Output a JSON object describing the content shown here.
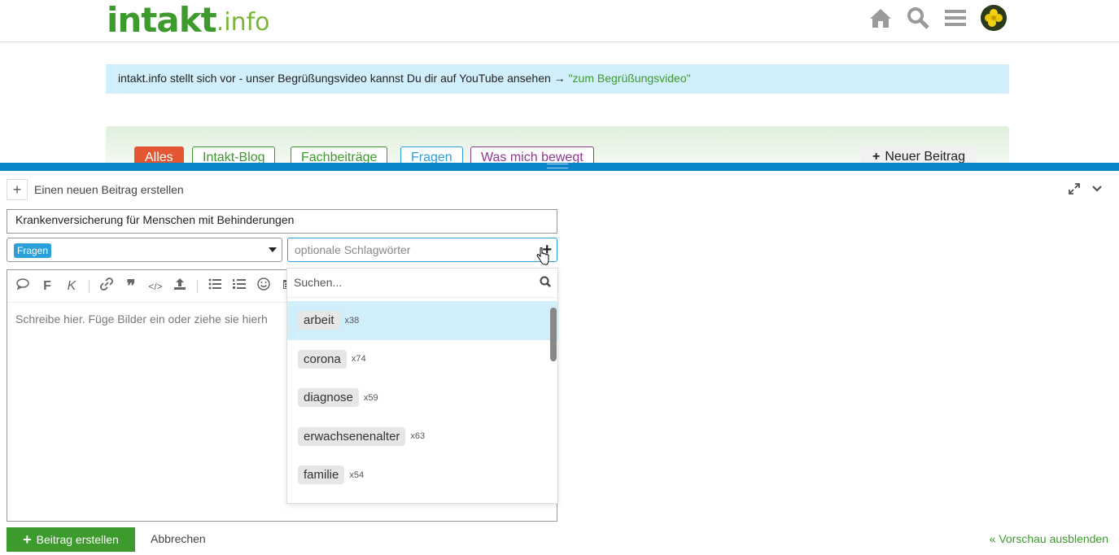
{
  "header": {
    "logo_main": "intakt",
    "logo_tld": ".info",
    "icons": [
      "home-icon",
      "search-icon",
      "hamburger-menu-icon",
      "avatar"
    ]
  },
  "banner": {
    "text": "intakt.info stellt sich vor - unser Begrüßungsvideo kannst Du dir auf YouTube ansehen → ",
    "link": "\"zum Begrüßungsvideo\""
  },
  "categories": {
    "items": [
      {
        "label": "Alles",
        "color": "#e45735",
        "active": true
      },
      {
        "label": "Intakt-Blog",
        "color": "#3d9a2c",
        "active": false
      },
      {
        "label": "Fachbeiträge",
        "color": "#3d9a2c",
        "active": false
      },
      {
        "label": "Fragen",
        "color": "#2a9fd8",
        "active": false
      },
      {
        "label": "Was mich bewegt",
        "color": "#8e3a8e",
        "active": false
      }
    ],
    "new_post": "Neuer Beitrag"
  },
  "composer": {
    "header_label": "Einen neuen Beitrag erstellen",
    "title_value": "Krankenversicherung für Menschen mit Behinderungen",
    "category_value": "Fragen",
    "tags_placeholder": "optionale Schlagwörter",
    "editor_placeholder": "Schreibe hier. Füge Bilder ein oder ziehe sie hierh",
    "toolbar": [
      "speech-bubble-icon",
      "bold-icon",
      "italic-icon",
      "link-icon",
      "quote-icon",
      "code-icon",
      "upload-icon",
      "bullet-list-icon",
      "numbered-list-icon",
      "emoji-icon",
      "calendar-icon"
    ],
    "submit_label": "Beitrag erstellen",
    "cancel_label": "Abbrechen",
    "preview_label": "« Vorschau ausblenden"
  },
  "tag_dropdown": {
    "search_placeholder": "Suchen...",
    "items": [
      {
        "name": "arbeit",
        "count": "x38",
        "highlighted": true
      },
      {
        "name": "corona",
        "count": "x74",
        "highlighted": false
      },
      {
        "name": "diagnose",
        "count": "x59",
        "highlighted": false
      },
      {
        "name": "erwachsenenalter",
        "count": "x63",
        "highlighted": false
      },
      {
        "name": "familie",
        "count": "x54",
        "highlighted": false
      }
    ]
  },
  "colors": {
    "brand_green": "#3d9a2c",
    "composer_blue": "#0a85c9",
    "banner_bg": "#d1eefb"
  }
}
